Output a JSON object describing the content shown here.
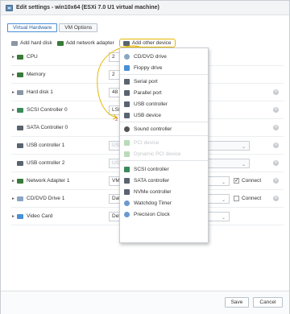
{
  "window": {
    "title": "Edit settings - win10x64 (ESXi 7.0 U1 virtual machine)"
  },
  "tabs": [
    {
      "label": "Virtual Hardware",
      "active": true
    },
    {
      "label": "VM Options",
      "active": false
    }
  ],
  "toolbar": {
    "add_hard_disk": "Add hard disk",
    "add_network_adapter": "Add network adapter",
    "add_other_device": "Add other device"
  },
  "annotations": {
    "step1": "1",
    "step2": "2"
  },
  "rows": [
    {
      "label": "CPU",
      "value": "2",
      "icon": "cpu-icon",
      "expandable": true
    },
    {
      "label": "Memory",
      "value": "2",
      "icon": "memory-icon",
      "expandable": true
    },
    {
      "label": "Hard disk 1",
      "value": "48",
      "icon": "hard-disk-icon",
      "expandable": true
    },
    {
      "label": "SCSI Controller 0",
      "value": "LSI",
      "icon": "scsi-controller-icon",
      "expandable": true
    },
    {
      "label": "SATA Controller 0",
      "value": "",
      "icon": "sata-controller-icon",
      "expandable": false
    },
    {
      "label": "USB controller 1",
      "value": "US",
      "icon": "usb-controller-icon",
      "expandable": false
    },
    {
      "label": "USB controller 2",
      "value": "US",
      "icon": "usb-controller-icon",
      "expandable": false
    },
    {
      "label": "Network Adapter 1",
      "value": "VM",
      "icon": "network-adapter-icon",
      "expandable": true,
      "connect_label": "Connect",
      "connect_checked": true
    },
    {
      "label": "CD/DVD Drive 1",
      "value": "Dat",
      "icon": "cd-dvd-icon",
      "expandable": true,
      "connect_label": "Connect",
      "connect_checked": false
    },
    {
      "label": "Video Card",
      "value": "Def",
      "icon": "video-card-icon",
      "expandable": true
    }
  ],
  "menu": {
    "items": [
      {
        "label": "CD/DVD drive",
        "icon": "cd-dvd-icon",
        "enabled": true
      },
      {
        "label": "Floppy drive",
        "icon": "floppy-icon",
        "enabled": true
      },
      {
        "label": "Serial port",
        "icon": "serial-port-icon",
        "enabled": true
      },
      {
        "label": "Parallel port",
        "icon": "parallel-port-icon",
        "enabled": true
      },
      {
        "label": "USB controller",
        "icon": "usb-controller-icon",
        "enabled": true
      },
      {
        "label": "USB device",
        "icon": "usb-device-icon",
        "enabled": true
      },
      {
        "label": "Sound controller",
        "icon": "sound-icon",
        "enabled": true
      },
      {
        "label": "PCI device",
        "icon": "pci-device-icon",
        "enabled": false
      },
      {
        "label": "Dynamic PCI device",
        "icon": "dynamic-pci-icon",
        "enabled": false
      },
      {
        "label": "SCSI controller",
        "icon": "scsi-controller-icon",
        "enabled": true
      },
      {
        "label": "SATA controller",
        "icon": "sata-controller-icon",
        "enabled": true
      },
      {
        "label": "NVMe controller",
        "icon": "nvme-controller-icon",
        "enabled": true
      },
      {
        "label": "Watchdog Timer",
        "icon": "watchdog-icon",
        "enabled": true
      },
      {
        "label": "Precision Clock",
        "icon": "clock-icon",
        "enabled": true
      }
    ]
  },
  "footer": {
    "save_label": "Save",
    "cancel_label": "Cancel"
  },
  "colors": {
    "accent": "#4a8fd6",
    "highlight": "#e6b800",
    "disabled": "#c3c7cb"
  }
}
